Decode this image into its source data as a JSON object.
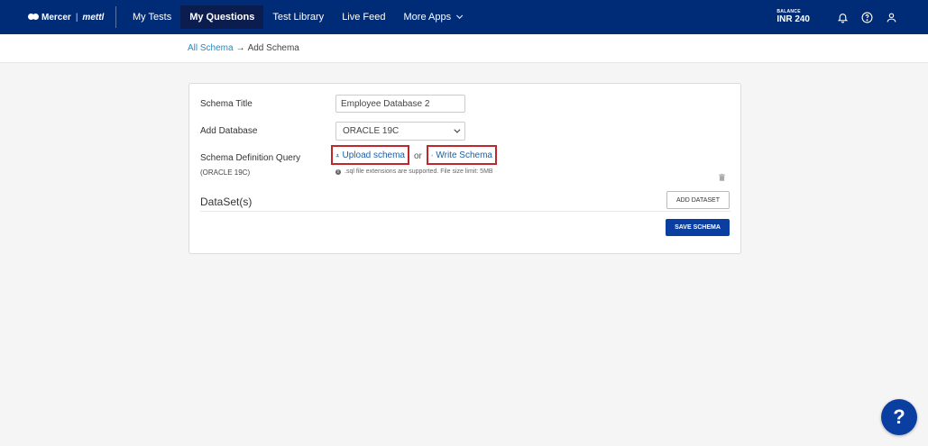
{
  "brand": {
    "name": "Mercer",
    "separator": "|",
    "sub": "mettl"
  },
  "nav": {
    "items": [
      {
        "label": "My Tests",
        "active": false
      },
      {
        "label": "My Questions",
        "active": true
      },
      {
        "label": "Test Library",
        "active": false
      },
      {
        "label": "Live Feed",
        "active": false
      },
      {
        "label": "More Apps",
        "active": false
      }
    ],
    "balance_label": "BALANCE",
    "balance_value": "INR 240",
    "icons": [
      "bell-icon",
      "help-circle-icon",
      "user-icon"
    ]
  },
  "breadcrumb": {
    "parent": "All Schema",
    "arrow": "→",
    "current": "Add Schema"
  },
  "form": {
    "title_label": "Schema Title",
    "title_value": "Employee Database 2",
    "database_label": "Add Database",
    "database_value": "ORACLE 19C",
    "definition_label": "Schema Definition Query",
    "definition_sub": "(ORACLE 19C)",
    "upload_label": "Upload schema",
    "or_text": "or",
    "write_label": "Write Schema",
    "hint": ".sql file extensions are supported. File size limit: 5MB",
    "datasets_title": "DataSet(s)",
    "add_dataset_label": "ADD DATASET",
    "save_label": "SAVE SCHEMA"
  },
  "help_fab": "?",
  "colors": {
    "nav_bg": "#002c77",
    "primary": "#0b3ea1",
    "highlight": "#c0272d",
    "link": "#1a8ccf"
  }
}
